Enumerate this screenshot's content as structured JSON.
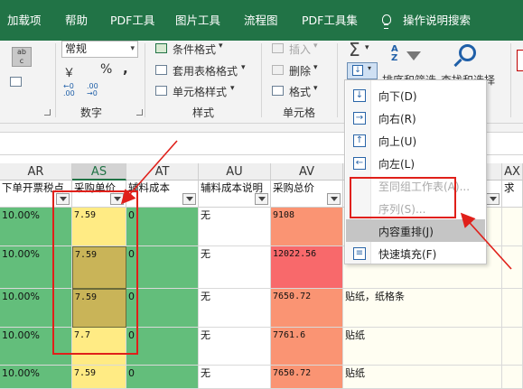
{
  "tabs": [
    "加载项",
    "帮助",
    "PDF工具",
    "图片工具",
    "流程图",
    "PDF工具集",
    "操作说明搜索"
  ],
  "ribbon": {
    "number_format": "常规",
    "currency_symbol": "￥",
    "percent_symbol": "%",
    "comma_symbol": ",",
    "dec_increase": "←0\n.00",
    "dec_decrease": ".00\n→0",
    "number_group": "数字",
    "styles": [
      "条件格式",
      "套用表格格式",
      "单元格样式"
    ],
    "styles_group": "样式",
    "cells": [
      "插入",
      "删除",
      "格式"
    ],
    "cells_group": "单元格",
    "sort_filter": "排序和筛选",
    "find_select": "查找和选择",
    "sigma": "Σ"
  },
  "grid": {
    "columns": [
      "AR",
      "AS",
      "AT",
      "AU",
      "AV",
      "AX"
    ],
    "headers": [
      "下单开票税点",
      "采购单价",
      "辅料成本",
      "辅料成本说明",
      "采购总价",
      "求"
    ],
    "rows": [
      {
        "AR": "10.00%",
        "AS": "7.59",
        "AT": "0",
        "AU": "无",
        "AV": "9108",
        "AW": ""
      },
      {
        "AR": "10.00%",
        "AS": "7.59",
        "AT": "0",
        "AU": "无",
        "AV": "12022.56",
        "AW": ""
      },
      {
        "AR": "10.00%",
        "AS": "7.59",
        "AT": "0",
        "AU": "无",
        "AV": "7650.72",
        "AW": "贴纸，纸格条"
      },
      {
        "AR": "10.00%",
        "AS": "7.7",
        "AT": "0",
        "AU": "无",
        "AV": "7761.6",
        "AW": "贴纸"
      },
      {
        "AR": "10.00%",
        "AS": "7.59",
        "AT": "0",
        "AU": "无",
        "AV": "7650.72",
        "AW": "贴纸"
      }
    ]
  },
  "fill_menu": {
    "items": [
      {
        "label": "向下(D)",
        "icon": "↓",
        "enabled": true
      },
      {
        "label": "向右(R)",
        "icon": "→",
        "enabled": true
      },
      {
        "label": "向上(U)",
        "icon": "↑",
        "enabled": true
      },
      {
        "label": "向左(L)",
        "icon": "←",
        "enabled": true
      },
      {
        "label": "至同组工作表(A)...",
        "icon": "",
        "enabled": false
      },
      {
        "label": "序列(S)...",
        "icon": "",
        "enabled": false
      },
      {
        "label": "内容重排(J)",
        "icon": "",
        "enabled": true
      },
      {
        "label": "快速填充(F)",
        "icon": "≡",
        "enabled": true
      }
    ]
  },
  "colors": {
    "tab_green": "#217346",
    "cell_green": "#63be7b",
    "cell_yellow": "#ffeb84",
    "cell_olive": "#c9b458",
    "cell_red": "#f8696b",
    "cell_orange": "#fa9473",
    "annotation_red": "#e0201a"
  }
}
